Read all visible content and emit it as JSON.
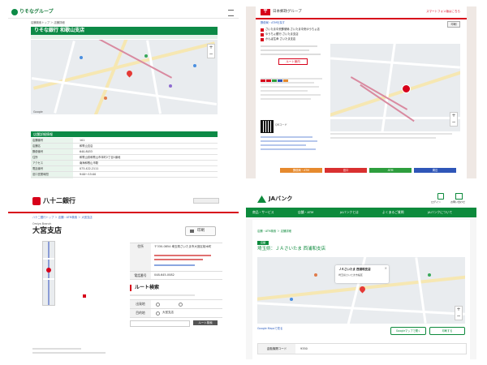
{
  "resona": {
    "logo_text": "りそなグループ",
    "breadcrumb": "店舗検索トップ ＞ 店舗詳細",
    "branch_title": "りそな銀行 和歌山支店",
    "map_credit": "Google",
    "section_title": "店舗詳細情報",
    "accent": "#0c8a46",
    "info_rows": [
      {
        "label": "店舗番号",
        "value": "101"
      },
      {
        "label": "店舗名",
        "value": "和歌山支店"
      },
      {
        "label": "郵便番号",
        "value": "640-8033"
      },
      {
        "label": "住所",
        "value": "和歌山県和歌山市本町2丁目1番地"
      },
      {
        "label": "アクセス",
        "value": "南海和歌山市駅"
      },
      {
        "label": "電話番号",
        "value": "073-422-2111"
      },
      {
        "label": "窓口営業時間",
        "value": "9:00〜15:00"
      },
      {
        "label": "ATM",
        "value": "あり"
      }
    ]
  },
  "post": {
    "logo_text": "日本郵政グループ",
    "top_link": "スマートフォン版はこちら",
    "print_button": "印刷",
    "breadcrumb": "郵便局・ATMを探す",
    "notices": [
      "さいたま中央郵便局 さいたま中央ゆうちょ店",
      "ゆうちょ銀行 さいたま支店",
      "かんぽ生命 さいたま支店"
    ],
    "route_button": "ルート案内",
    "qr_label": "QRコード",
    "tabs": [
      "郵便局・ATM",
      "窓口",
      "ATM",
      "周辺"
    ],
    "tab_colors": [
      "#e68a2e",
      "#d93030",
      "#2e9e3e",
      "#2f56b8"
    ],
    "accent": "#d7001a"
  },
  "hachi": {
    "logo_text": "八十二銀行",
    "breadcrumb": "八十二銀行トップ ＞ 店舗・ATM検索 ＞ 大宮支店",
    "branch_title": "大宮支店",
    "branch_sub": "Omiya Branch",
    "print_button": "印刷",
    "info": [
      {
        "label": "住所",
        "value": "〒330-0854 埼玉県さいたま市大宮区桜木町"
      },
      {
        "label": "電話番号",
        "value": "048-645-0082"
      }
    ],
    "route_title": "ルート検索",
    "route_rows": [
      {
        "label": "出発地",
        "value": ""
      },
      {
        "label": "目的地",
        "value": "大宮支店"
      }
    ],
    "route_button": "ルート検索",
    "accent": "#d7001a"
  },
  "ja": {
    "logo_text": "JAバンク",
    "header_icons": [
      "ログイン",
      "お問い合わせ"
    ],
    "nav": [
      "商品・サービス",
      "店舗・ATM",
      "JAバンクとは",
      "よくあるご質問",
      "JAバンクについて"
    ],
    "breadcrumb": "店舗・ATM検索 ＞ 店舗詳細",
    "badge": "店舗",
    "branch_title": "埼玉県：ＪＡさいたま 西浦和支店",
    "popup_title": "ＪＡさいたま 西浦和支店",
    "popup_address": "埼玉県さいたま市桜区",
    "map_link": "Google Mapsで見る",
    "button_google": "Googleマップで開く",
    "button_print": "印刷する",
    "table_label": "金融機関コード",
    "table_value": "9350",
    "accent": "#0d8a3c"
  }
}
